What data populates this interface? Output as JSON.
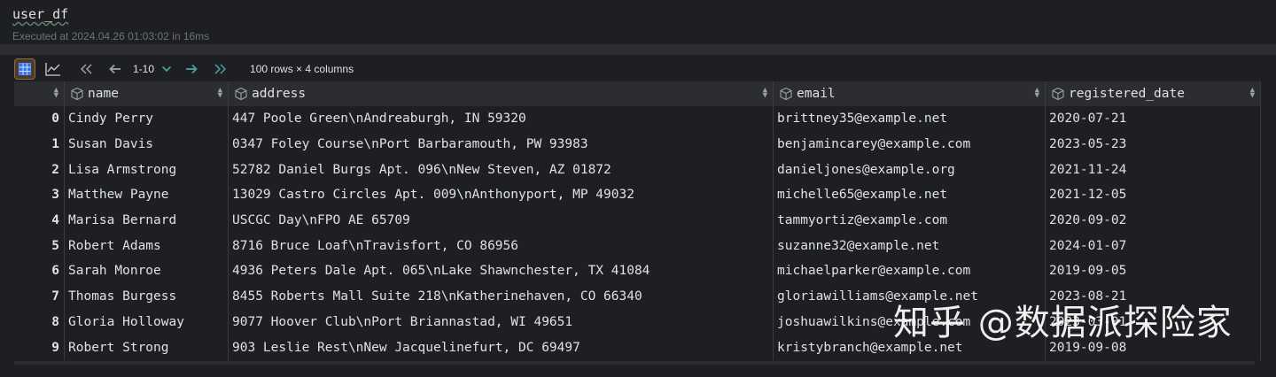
{
  "cell": {
    "code": "user_df",
    "execution_info": "Executed at 2024.04.26 01:03:02 in 16ms"
  },
  "toolbar": {
    "table_view_icon": "table-grid-icon",
    "chart_view_icon": "line-chart-icon",
    "page_range": "1-10",
    "rows_info": "100 rows × 4 columns"
  },
  "table": {
    "columns": [
      "name",
      "address",
      "email",
      "registered_date"
    ],
    "rows": [
      {
        "index": "0",
        "name": "Cindy Perry",
        "address": "447 Poole Green\\nAndreaburgh, IN 59320",
        "email": "brittney35@example.net",
        "registered_date": "2020-07-21"
      },
      {
        "index": "1",
        "name": "Susan Davis",
        "address": "0347 Foley Course\\nPort Barbaramouth, PW 93983",
        "email": "benjamincarey@example.com",
        "registered_date": "2023-05-23"
      },
      {
        "index": "2",
        "name": "Lisa Armstrong",
        "address": "52782 Daniel Burgs Apt. 096\\nNew Steven, AZ 01872",
        "email": "danieljones@example.org",
        "registered_date": "2021-11-24"
      },
      {
        "index": "3",
        "name": "Matthew Payne",
        "address": "13029 Castro Circles Apt. 009\\nAnthonyport, MP 49032",
        "email": "michelle65@example.net",
        "registered_date": "2021-12-05"
      },
      {
        "index": "4",
        "name": "Marisa Bernard",
        "address": "USCGC Day\\nFPO AE 65709",
        "email": "tammyortiz@example.com",
        "registered_date": "2020-09-02"
      },
      {
        "index": "5",
        "name": "Robert Adams",
        "address": "8716 Bruce Loaf\\nTravisfort, CO 86956",
        "email": "suzanne32@example.net",
        "registered_date": "2024-01-07"
      },
      {
        "index": "6",
        "name": "Sarah Monroe",
        "address": "4936 Peters Dale Apt. 065\\nLake Shawnchester, TX 41084",
        "email": "michaelparker@example.com",
        "registered_date": "2019-09-05"
      },
      {
        "index": "7",
        "name": "Thomas Burgess",
        "address": "8455 Roberts Mall Suite 218\\nKatherinehaven, CO 66340",
        "email": "gloriawilliams@example.net",
        "registered_date": "2023-08-21"
      },
      {
        "index": "8",
        "name": "Gloria Holloway",
        "address": "9077 Hoover Club\\nPort Briannastad, WI 49651",
        "email": "joshuawilkins@example.com",
        "registered_date": "2023-03-01"
      },
      {
        "index": "9",
        "name": "Robert Strong",
        "address": "903 Leslie Rest\\nNew Jacquelinefurt, DC 69497",
        "email": "kristybranch@example.net",
        "registered_date": "2019-09-08"
      }
    ]
  },
  "watermark": "知乎 @数据派探险家",
  "colors": {
    "background": "#1e1f22",
    "header_bg": "#2b2d30",
    "active_view": "#8a6d3b",
    "next_arrow": "#4aa3a2"
  }
}
